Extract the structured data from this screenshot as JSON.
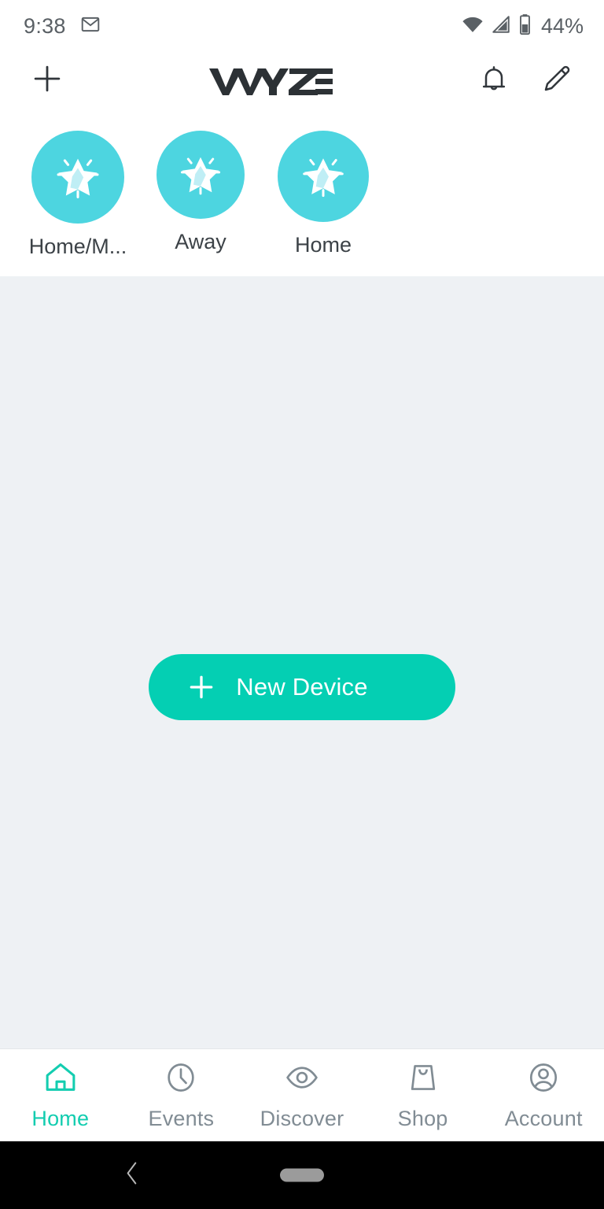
{
  "status_bar": {
    "time": "9:38",
    "gmail_icon": "gmail-icon",
    "wifi_icon": "wifi-icon",
    "cellular_icon": "cellular-signal-icon",
    "battery_icon": "battery-icon",
    "battery_text": "44%"
  },
  "header": {
    "add_icon": "plus-icon",
    "logo_text": "WYZE",
    "notifications_icon": "bell-icon",
    "edit_icon": "pencil-icon"
  },
  "shortcuts": [
    {
      "label": "Home/M...",
      "icon": "star-sparkle-icon",
      "color": "#4dd5e0"
    },
    {
      "label": "Away",
      "icon": "star-sparkle-icon",
      "color": "#4dd5e0"
    },
    {
      "label": "Home",
      "icon": "star-sparkle-icon",
      "color": "#4dd5e0"
    }
  ],
  "main": {
    "new_device_label": "New Device",
    "new_device_icon": "plus-icon",
    "new_device_color": "#04cfb3",
    "background_color": "#eef1f4"
  },
  "bottom_nav": {
    "active_color": "#13cdb0",
    "inactive_color": "#818c94",
    "items": [
      {
        "label": "Home",
        "icon": "house-icon",
        "active": true
      },
      {
        "label": "Events",
        "icon": "clock-icon",
        "active": false
      },
      {
        "label": "Discover",
        "icon": "eye-icon",
        "active": false
      },
      {
        "label": "Shop",
        "icon": "shopping-bag-icon",
        "active": false
      },
      {
        "label": "Account",
        "icon": "person-circle-icon",
        "active": false
      }
    ]
  },
  "android_nav": {
    "back_icon": "back-chevron-icon",
    "home_pill": "home-pill-indicator"
  }
}
